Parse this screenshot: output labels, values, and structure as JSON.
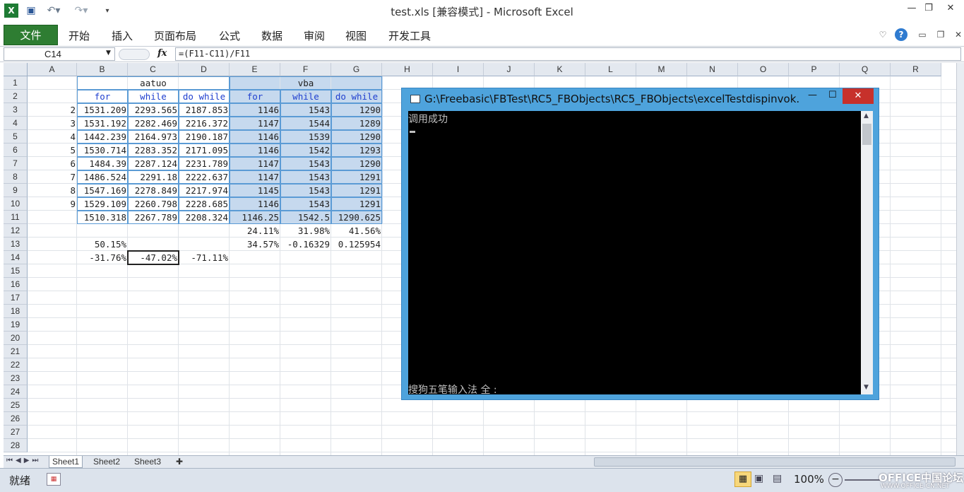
{
  "window": {
    "title": "test.xls  [兼容模式] - Microsoft Excel"
  },
  "icons": {
    "excel": "excel-app-icon",
    "save": "save-icon",
    "undo": "undo-icon",
    "redo": "redo-icon",
    "customize": "qat-customize-icon",
    "minimize": "minimize-icon",
    "restore": "restore-icon",
    "close": "close-icon",
    "help": "help-icon",
    "fx": "function-icon"
  },
  "ribbon": {
    "file_label": "文件",
    "tabs": [
      "开始",
      "插入",
      "页面布局",
      "公式",
      "数据",
      "审阅",
      "视图",
      "开发工具"
    ]
  },
  "formula_bar": {
    "name_box": "C14",
    "fx_label": "fx",
    "formula": "=(F11-C11)/F11"
  },
  "grid": {
    "columns": [
      "A",
      "B",
      "C",
      "D",
      "E",
      "F",
      "G",
      "H",
      "I",
      "J",
      "K",
      "L",
      "M",
      "N",
      "O",
      "P",
      "Q",
      "R"
    ],
    "rows": [
      "1",
      "2",
      "3",
      "4",
      "5",
      "6",
      "7",
      "8",
      "9",
      "10",
      "11",
      "12",
      "13",
      "14",
      "15",
      "16",
      "17",
      "18",
      "19",
      "20",
      "21",
      "22",
      "23",
      "24",
      "25",
      "26",
      "27",
      "28"
    ],
    "headers": {
      "aatuo": "aatuo",
      "vba": "vba"
    },
    "subheaders": [
      "for",
      "while",
      "do while",
      "for",
      "while",
      "do while"
    ],
    "data": [
      [
        "2",
        "1531.209",
        "2293.565",
        "2187.853",
        "1146",
        "1543",
        "1290"
      ],
      [
        "3",
        "1531.192",
        "2282.469",
        "2216.372",
        "1147",
        "1544",
        "1289"
      ],
      [
        "4",
        "1442.239",
        "2164.973",
        "2190.187",
        "1146",
        "1539",
        "1290"
      ],
      [
        "5",
        "1530.714",
        "2283.352",
        "2171.095",
        "1146",
        "1542",
        "1293"
      ],
      [
        "6",
        "1484.39",
        "2287.124",
        "2231.789",
        "1147",
        "1543",
        "1290"
      ],
      [
        "7",
        "1486.524",
        "2291.18",
        "2222.637",
        "1147",
        "1543",
        "1291"
      ],
      [
        "8",
        "1547.169",
        "2278.849",
        "2217.974",
        "1145",
        "1543",
        "1291"
      ],
      [
        "9",
        "1529.109",
        "2260.798",
        "2228.685",
        "1146",
        "1543",
        "1291"
      ],
      [
        "",
        "1510.318",
        "2267.789",
        "2208.324",
        "1146.25",
        "1542.5",
        "1290.625"
      ]
    ],
    "row12": {
      "E": "24.11%",
      "F": "31.98%",
      "G": "41.56%"
    },
    "row13": {
      "B": "50.15%",
      "E": "34.57%",
      "F": "-0.16329",
      "G": "0.125954"
    },
    "row14": {
      "B": "-31.76%",
      "C": "-47.02%",
      "D": "-71.11%"
    }
  },
  "sheets": [
    "Sheet1",
    "Sheet2",
    "Sheet3"
  ],
  "status": {
    "ready": "就绪",
    "zoom": "100%",
    "watermark": "OFFICE中国论坛",
    "watermark_url": "WWW.OFFICE-CN.NET"
  },
  "console": {
    "title": "G:\\Freebasic\\FBTest\\RC5_FBObjects\\RC5_FBObjects\\excelTestdispinvok...",
    "output_line": "调用成功",
    "ime_status": "搜狗五笔输入法 全 :"
  }
}
